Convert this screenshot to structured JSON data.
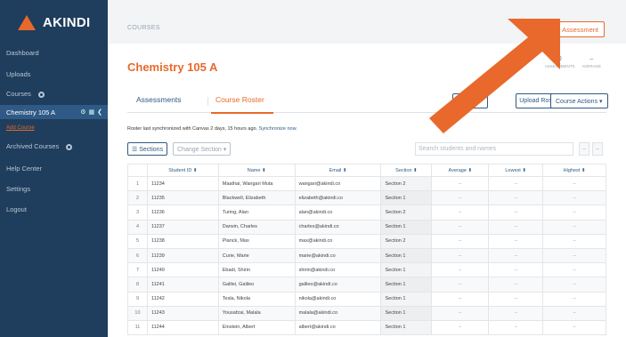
{
  "brand": {
    "name": "AKINDI",
    "accent": "#e8692b",
    "sidebar_bg": "#1f3d5c"
  },
  "sidebar": {
    "items": [
      {
        "label": "Dashboard"
      },
      {
        "label": "Uploads"
      },
      {
        "label": "Courses"
      },
      {
        "label": "Chemistry 105 A"
      },
      {
        "label": "Add Course"
      },
      {
        "label": "Archived Courses"
      },
      {
        "label": "Help Center"
      },
      {
        "label": "Settings"
      },
      {
        "label": "Logout"
      }
    ]
  },
  "header": {
    "breadcrumb": "COURSES",
    "create_button": "Create Assessment"
  },
  "course": {
    "title": "Chemistry 105 A",
    "stats": [
      {
        "value": "0",
        "label": "ASSESSMENTS"
      },
      {
        "value": "–",
        "label": "AVERAGE"
      }
    ]
  },
  "tabs": {
    "assessments": "Assessments",
    "roster": "Course Roster",
    "collect_button": "Colle",
    "upload_roster_button": "Upload Roster",
    "course_actions_button": "Course Actions ▾"
  },
  "roster_info": {
    "text": "Roster last synchronized with Canvas 2 days, 15 hours ago.",
    "link": "Synchronize now."
  },
  "controls": {
    "sections_button": "☰ Sections",
    "change_section_button": "Change Section ▾",
    "search_placeholder": "Search students and names",
    "minus1": "–",
    "minus2": "–"
  },
  "table": {
    "headers": [
      "",
      "Student ID ⬍",
      "Name ⬍",
      "Email ⬍",
      "Section ⬍",
      "Average ⬍",
      "Lowest ⬍",
      "Highest ⬍"
    ],
    "rows": [
      [
        "1",
        "11234",
        "Maathai, Wangari Muta",
        "wangari@akindi.co",
        "Section 2",
        "–",
        "–",
        "–"
      ],
      [
        "2",
        "11235",
        "Blackwell, Elizabeth",
        "elizabeth@akindi.co",
        "Section 1",
        "–",
        "–",
        "–"
      ],
      [
        "3",
        "11236",
        "Turing, Alan",
        "alan@akindi.co",
        "Section 2",
        "–",
        "–",
        "–"
      ],
      [
        "4",
        "11237",
        "Darwin, Charles",
        "charles@akindi.co",
        "Section 1",
        "–",
        "–",
        "–"
      ],
      [
        "5",
        "11238",
        "Planck, Max",
        "max@akindi.co",
        "Section 2",
        "–",
        "–",
        "–"
      ],
      [
        "6",
        "11239",
        "Curie, Marie",
        "marie@akindi.co",
        "Section 1",
        "–",
        "–",
        "–"
      ],
      [
        "7",
        "11240",
        "Ebadi, Shirin",
        "shirin@akindi.co",
        "Section 1",
        "–",
        "–",
        "–"
      ],
      [
        "8",
        "11241",
        "Galilei, Galileo",
        "galileo@akindi.co",
        "Section 1",
        "–",
        "–",
        "–"
      ],
      [
        "9",
        "11242",
        "Tesla, Nikola",
        "nikola@akindi.co",
        "Section 1",
        "–",
        "–",
        "–"
      ],
      [
        "10",
        "11243",
        "Yousafzai, Malala",
        "malala@akindi.co",
        "Section 1",
        "–",
        "–",
        "–"
      ],
      [
        "11",
        "11244",
        "Einstein, Albert",
        "albert@akindi.co",
        "Section 1",
        "–",
        "–",
        "–"
      ]
    ]
  }
}
